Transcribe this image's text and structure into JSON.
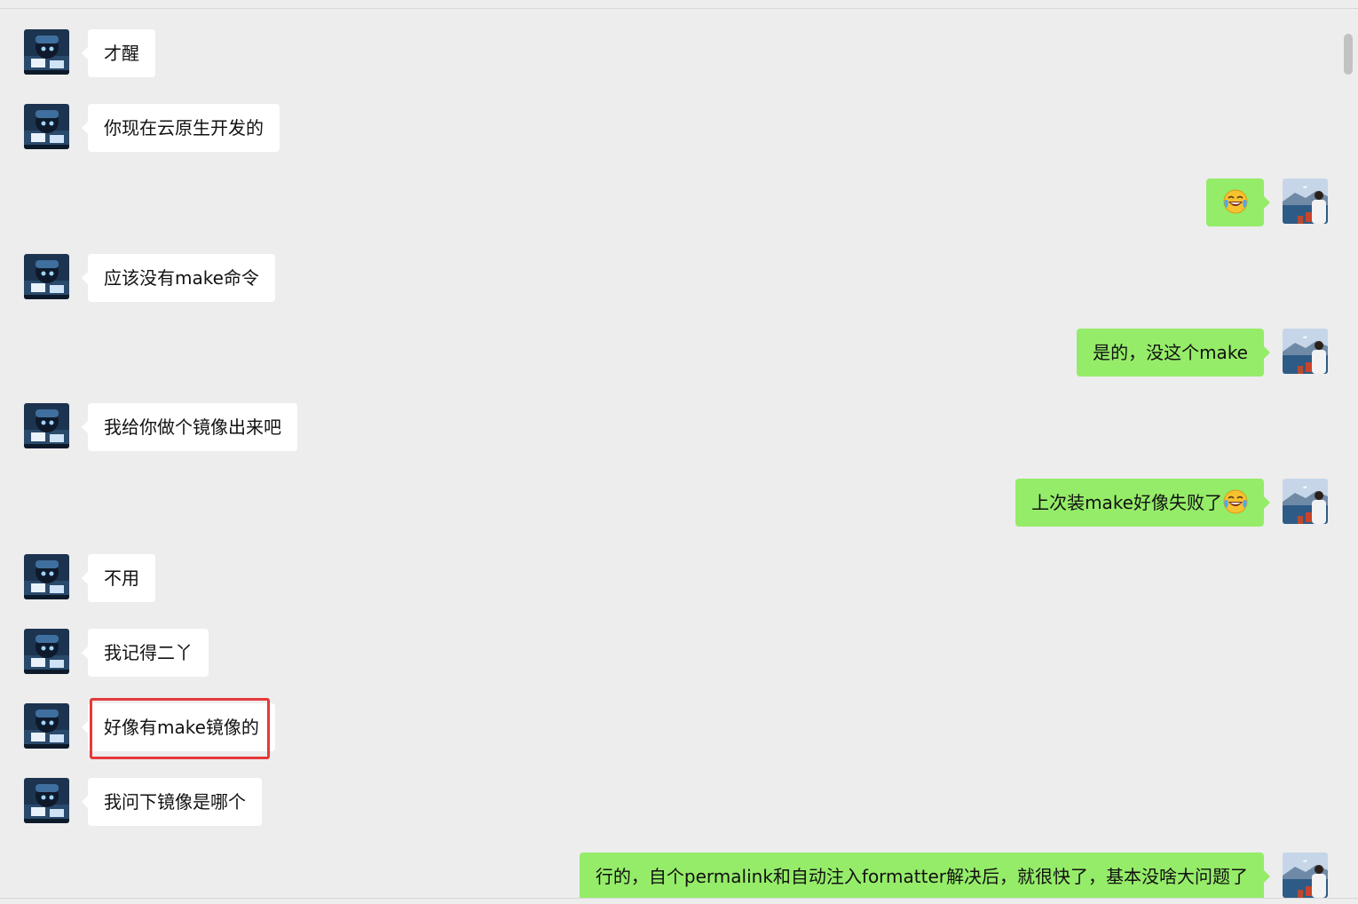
{
  "messages": [
    {
      "side": "in",
      "text": "才醒"
    },
    {
      "side": "in",
      "text": "你现在云原生开发的"
    },
    {
      "side": "out",
      "text": "",
      "emoji": "laughing-tears-emoji"
    },
    {
      "side": "in",
      "text": "应该没有make命令"
    },
    {
      "side": "out",
      "text": "是的，没这个make"
    },
    {
      "side": "in",
      "text": "我给你做个镜像出来吧"
    },
    {
      "side": "out",
      "text": "上次装make好像失败了",
      "emoji": "laughing-tears-emoji"
    },
    {
      "side": "in",
      "text": "不用"
    },
    {
      "side": "in",
      "text": "我记得二丫"
    },
    {
      "side": "in",
      "text": "好像有make镜像的",
      "highlighted": true
    },
    {
      "side": "in",
      "text": "我问下镜像是哪个"
    },
    {
      "side": "out",
      "text": "行的，自个permalink和自动注入formatter解决后，就很快了，基本没啥大问题了"
    }
  ],
  "colors": {
    "background": "#ededed",
    "incoming_bubble": "#ffffff",
    "outgoing_bubble": "#95ec69",
    "highlight_box": "#e5393a"
  },
  "icons": {
    "incoming_avatar": "anime-character-avatar",
    "outgoing_avatar": "seaside-photo-avatar"
  }
}
